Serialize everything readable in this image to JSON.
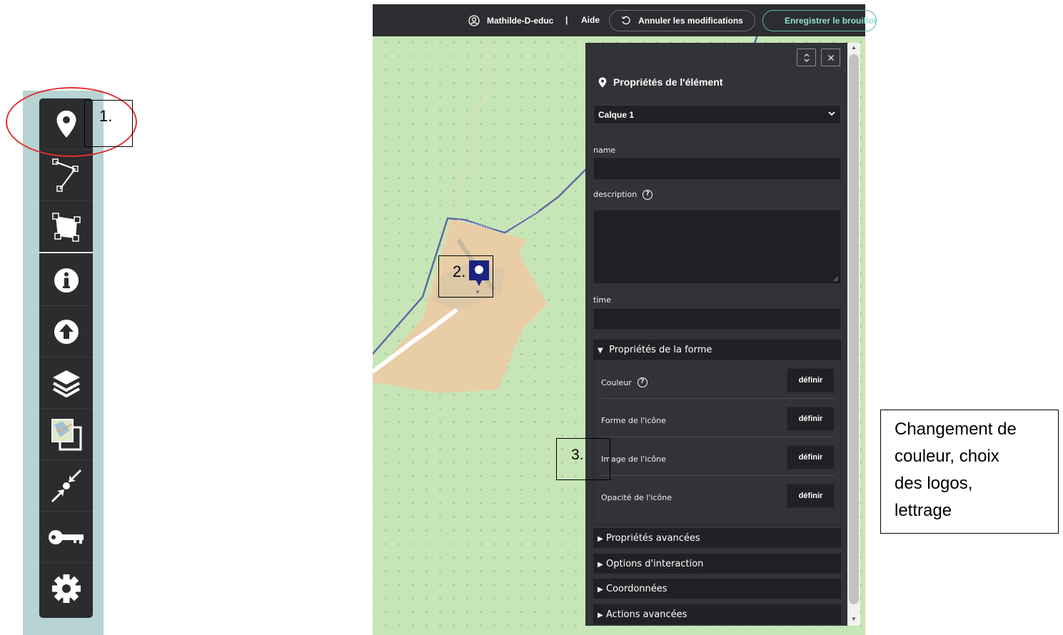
{
  "toolbar": {
    "tools": [
      {
        "name": "marker-tool",
        "icon": "map-marker-icon"
      },
      {
        "name": "line-tool",
        "icon": "polyline-icon"
      },
      {
        "name": "polygon-tool",
        "icon": "polygon-icon"
      },
      {
        "name": "info-tool",
        "icon": "info-icon"
      },
      {
        "name": "import-tool",
        "icon": "upload-icon"
      },
      {
        "name": "layers-tool",
        "icon": "layers-icon"
      },
      {
        "name": "background-tool",
        "icon": "map-tiles-icon"
      },
      {
        "name": "share-tool",
        "icon": "compress-arrows-icon"
      },
      {
        "name": "permissions-tool",
        "icon": "key-icon"
      },
      {
        "name": "settings-tool",
        "icon": "gear-icon"
      }
    ]
  },
  "annotations": {
    "step1": "1.",
    "step2": "2.",
    "step3": "3.",
    "callout_lines": [
      "Changement de",
      "couleur, choix",
      "des logos,",
      "lettrage"
    ]
  },
  "header": {
    "username": "Mathilde-D-educ",
    "separator": "|",
    "help": "Aide",
    "cancel_label": "Annuler les modifications",
    "save_label": "Enregistrer le brouillon"
  },
  "panel": {
    "title": "Propriétés de l'élément",
    "layer_select": "Calque 1",
    "fields": {
      "name_label": "name",
      "description_label": "description",
      "time_label": "time"
    },
    "shape_section": {
      "title": "Propriétés de la forme",
      "rows": [
        {
          "label": "Couleur",
          "button": "définir",
          "help": "?"
        },
        {
          "label": "Forme de l'icône",
          "button": "définir"
        },
        {
          "label": "Image de l'icône",
          "button": "définir"
        },
        {
          "label": "Opacité de l'icône",
          "button": "définir"
        }
      ]
    },
    "sections": [
      {
        "title": "Propriétés avancées"
      },
      {
        "title": "Options d'interaction"
      },
      {
        "title": "Coordonnées"
      },
      {
        "title": "Actions avancées"
      }
    ],
    "description_help": "?"
  },
  "colors": {
    "toolbar_bg": "#2b2c2e",
    "map_land": "#c7e6b7",
    "site_area": "#e8cda6",
    "marker": "#1a237e",
    "save_accent": "#8ee2d0"
  }
}
